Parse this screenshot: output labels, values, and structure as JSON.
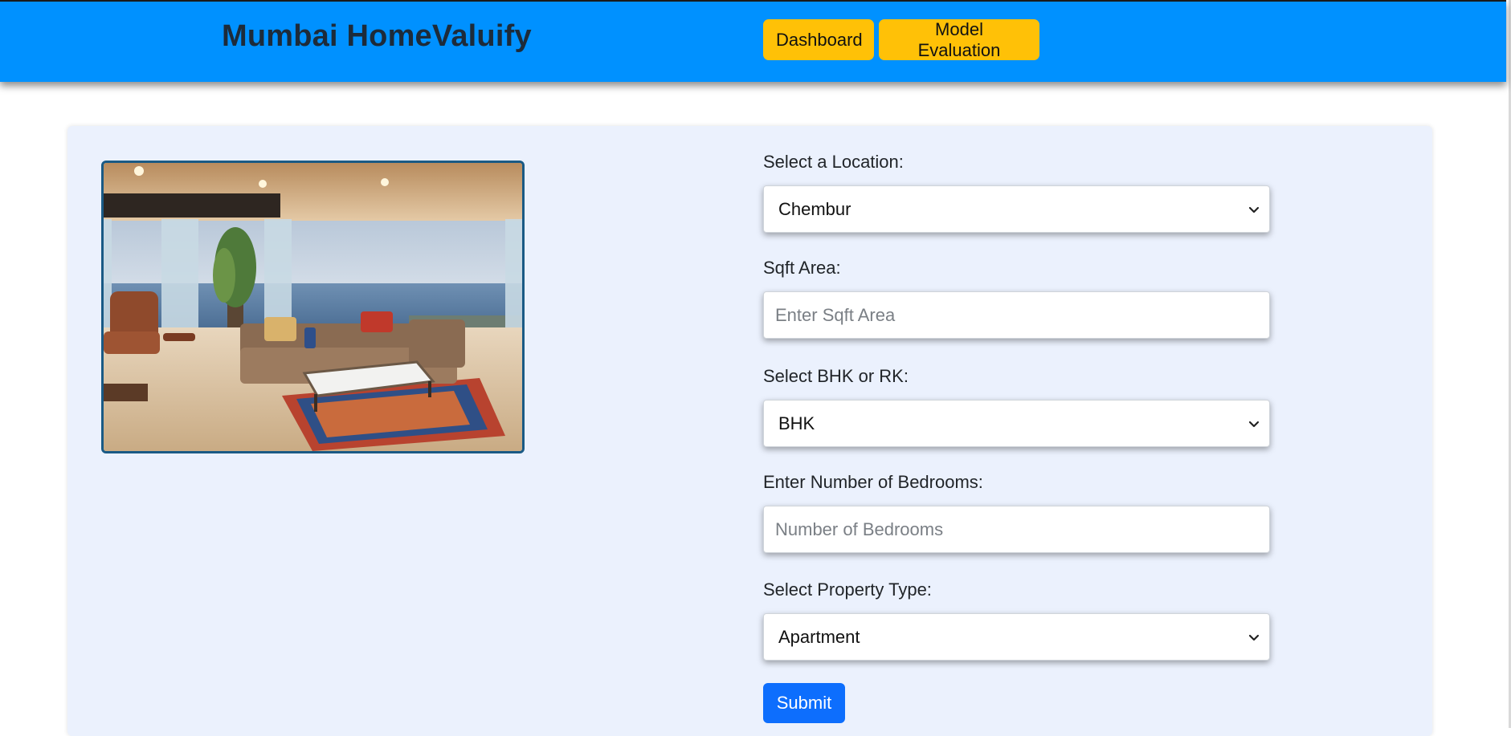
{
  "brand": {
    "title": "Mumbai HomeValuify"
  },
  "nav": {
    "dashboard_label": "Dashboard",
    "model_evaluation_label": "Model Evaluation"
  },
  "hero_image": {
    "description": "living-room-sea-view-photo"
  },
  "form": {
    "location": {
      "label": "Select a Location:",
      "value": "Chembur"
    },
    "sqft": {
      "label": "Sqft Area:",
      "placeholder": "Enter Sqft Area",
      "value": ""
    },
    "bhk_rk": {
      "label": "Select BHK or RK:",
      "value": "BHK"
    },
    "bedrooms": {
      "label": "Enter Number of Bedrooms:",
      "placeholder": "Number of Bedrooms",
      "value": ""
    },
    "property_type": {
      "label": "Select Property Type:",
      "value": "Apartment"
    },
    "submit_label": "Submit"
  },
  "colors": {
    "navbar": "#0091ff",
    "nav_button": "#ffc107",
    "submit": "#0d6efd",
    "card_bg": "#ebf1fd",
    "brand_text": "#1d2b3a"
  }
}
